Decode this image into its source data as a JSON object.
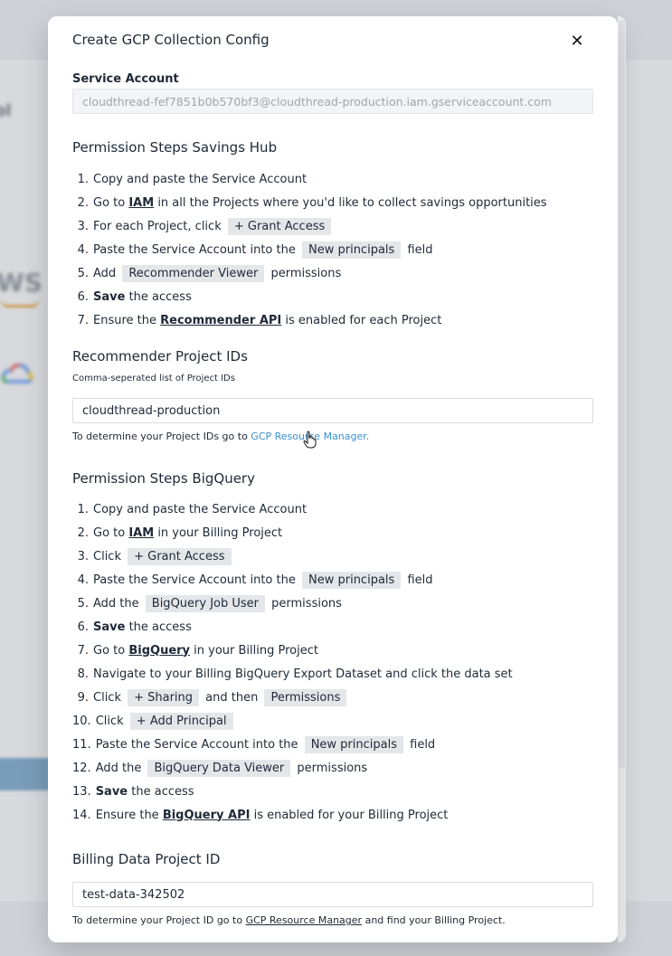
{
  "modal": {
    "title": "Create GCP Collection Config",
    "close_icon": "close-icon",
    "service_account": {
      "label": "Service Account",
      "value": "cloudthread-fef7851b0b570bf3@cloudthread-production.iam.gserviceaccount.com"
    },
    "savings_hub": {
      "title": "Permission Steps Savings Hub",
      "steps": [
        {
          "num": "1.",
          "parts": [
            {
              "t": "Copy and paste the Service Account"
            }
          ]
        },
        {
          "num": "2.",
          "parts": [
            {
              "t": "Go to "
            },
            {
              "t": "IAM",
              "s": "lnk"
            },
            {
              "t": " in all the Projects where you'd like to collect savings opportunities"
            }
          ]
        },
        {
          "num": "3.",
          "parts": [
            {
              "t": "For each Project, click "
            },
            {
              "t": "+ Grant Access",
              "s": "chip"
            }
          ]
        },
        {
          "num": "4.",
          "parts": [
            {
              "t": "Paste the Service Account into the "
            },
            {
              "t": "New principals",
              "s": "chip"
            },
            {
              "t": " field"
            }
          ]
        },
        {
          "num": "5.",
          "parts": [
            {
              "t": "Add "
            },
            {
              "t": "Recommender Viewer",
              "s": "chip"
            },
            {
              "t": " permissions"
            }
          ]
        },
        {
          "num": "6.",
          "parts": [
            {
              "t": "Save",
              "s": "b"
            },
            {
              "t": " the access"
            }
          ]
        },
        {
          "num": "7.",
          "parts": [
            {
              "t": "Ensure the "
            },
            {
              "t": "Recommender API",
              "s": "lnk"
            },
            {
              "t": " is enabled for each Project"
            }
          ]
        }
      ]
    },
    "recommender": {
      "title": "Recommender Project IDs",
      "hint": "Comma-seperated list of Project IDs",
      "value": "cloudthread-production",
      "help_prefix": "To determine your Project IDs go to ",
      "help_link": "GCP Resource Manager."
    },
    "bigquery": {
      "title": "Permission Steps BigQuery",
      "steps": [
        {
          "num": "1.",
          "parts": [
            {
              "t": "Copy and paste the Service Account"
            }
          ]
        },
        {
          "num": "2.",
          "parts": [
            {
              "t": "Go to "
            },
            {
              "t": "IAM",
              "s": "lnk"
            },
            {
              "t": " in your Billing Project"
            }
          ]
        },
        {
          "num": "3.",
          "parts": [
            {
              "t": "Click "
            },
            {
              "t": "+ Grant Access",
              "s": "chip"
            }
          ]
        },
        {
          "num": "4.",
          "parts": [
            {
              "t": "Paste the Service Account into the "
            },
            {
              "t": "New principals",
              "s": "chip"
            },
            {
              "t": " field"
            }
          ]
        },
        {
          "num": "5.",
          "parts": [
            {
              "t": "Add the "
            },
            {
              "t": "BigQuery Job User",
              "s": "chip"
            },
            {
              "t": " permissions"
            }
          ]
        },
        {
          "num": "6.",
          "parts": [
            {
              "t": "Save",
              "s": "b"
            },
            {
              "t": " the access"
            }
          ]
        },
        {
          "num": "7.",
          "parts": [
            {
              "t": "Go to "
            },
            {
              "t": "BigQuery",
              "s": "lnk"
            },
            {
              "t": " in your Billing Project"
            }
          ]
        },
        {
          "num": "8.",
          "parts": [
            {
              "t": "Navigate to your Billing BigQuery Export Dataset and click the data set"
            }
          ]
        },
        {
          "num": "9.",
          "parts": [
            {
              "t": "Click "
            },
            {
              "t": "+ Sharing",
              "s": "chip"
            },
            {
              "t": " and then "
            },
            {
              "t": "Permissions",
              "s": "chip"
            }
          ]
        },
        {
          "num": "10.",
          "parts": [
            {
              "t": "Click "
            },
            {
              "t": "+ Add Principal",
              "s": "chip"
            }
          ]
        },
        {
          "num": "11.",
          "parts": [
            {
              "t": "Paste the Service Account into the "
            },
            {
              "t": "New principals",
              "s": "chip"
            },
            {
              "t": " field"
            }
          ]
        },
        {
          "num": "12.",
          "parts": [
            {
              "t": "Add the "
            },
            {
              "t": "BigQuery Data Viewer",
              "s": "chip"
            },
            {
              "t": " permissions"
            }
          ]
        },
        {
          "num": "13.",
          "parts": [
            {
              "t": "Save",
              "s": "b"
            },
            {
              "t": " the access"
            }
          ]
        },
        {
          "num": "14.",
          "parts": [
            {
              "t": "Ensure the "
            },
            {
              "t": "BigQuery API",
              "s": "lnk"
            },
            {
              "t": " is enabled for your Billing Project"
            }
          ]
        }
      ]
    },
    "billing": {
      "title": "Billing Data Project ID",
      "value": "test-data-342502",
      "help_prefix": "To determine your Project ID go to ",
      "help_link": "GCP Resource Manager",
      "help_suffix": " and find your Billing Project."
    }
  },
  "colors": {
    "link_blue": "#3b8fd1",
    "chip_bg": "#e4e6ea",
    "aws_orange": "#e3a23b"
  }
}
